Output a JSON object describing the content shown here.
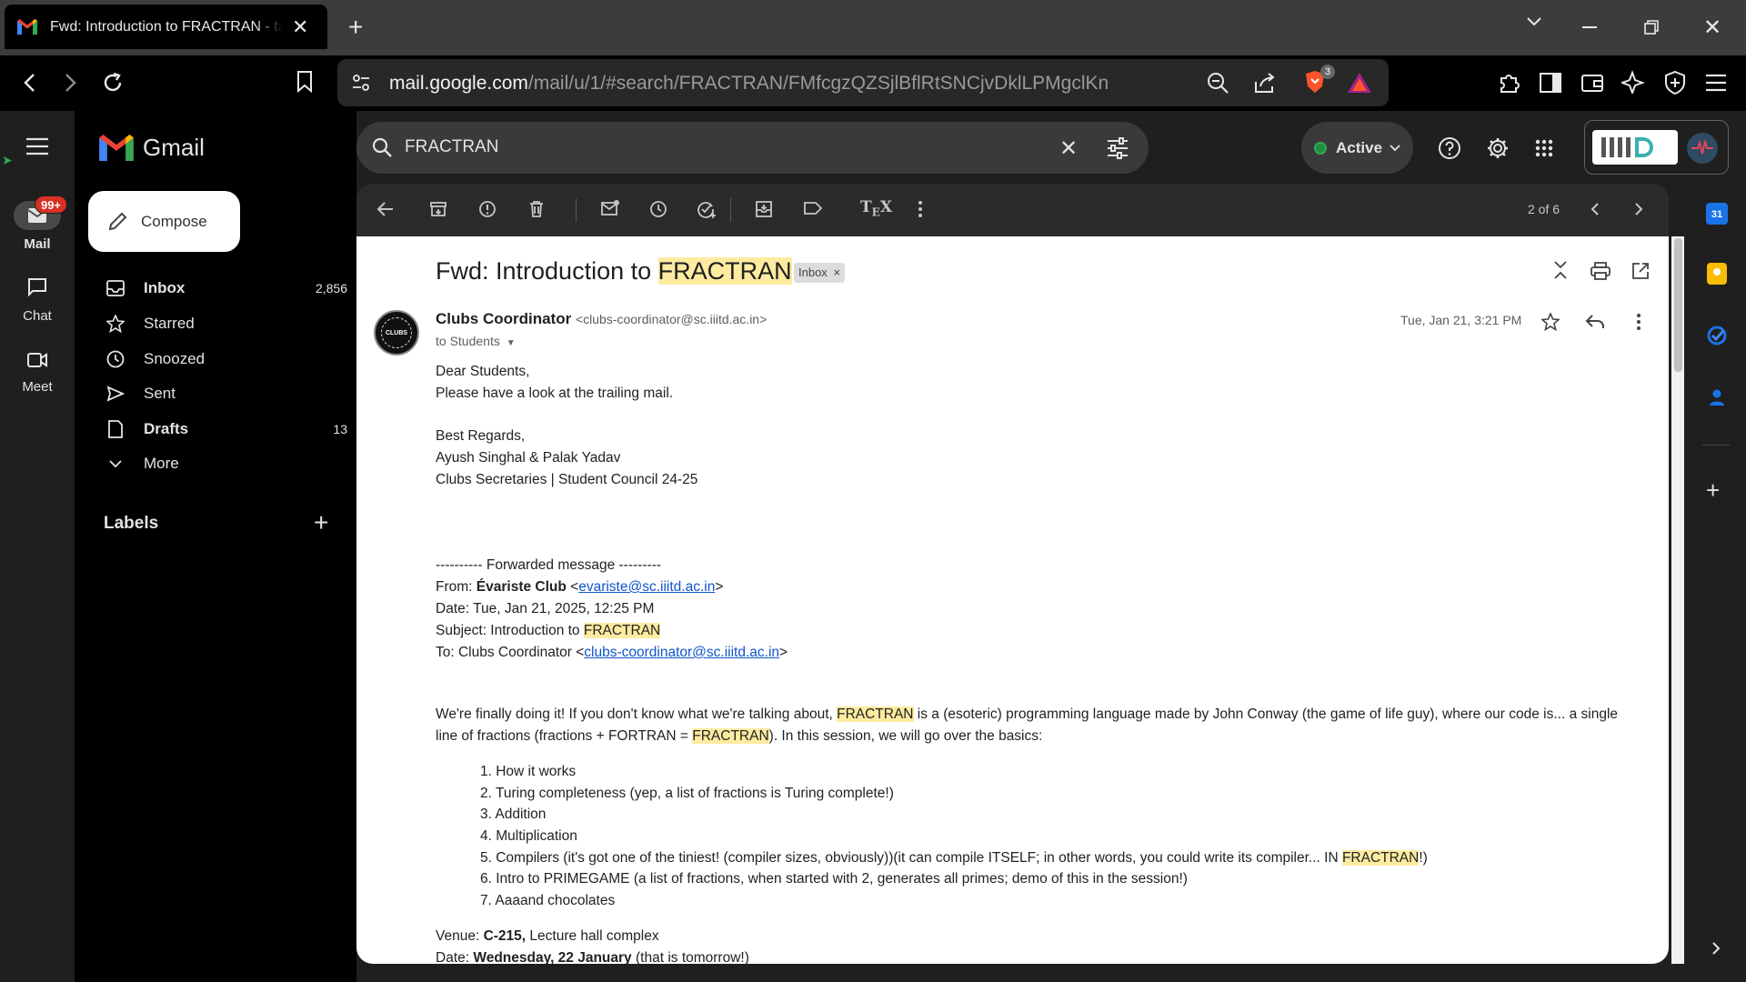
{
  "browser": {
    "tab_title": "Fwd: Introduction to FRACTRAN - tara",
    "url_domain": "mail.google.com",
    "url_path": "/mail/u/1/#search/FRACTRAN/FMfcgzQZSjlBflRtSNCjvDklLPMgclKn",
    "brave_badge": "3"
  },
  "rail": {
    "mail_label": "Mail",
    "mail_badge": "99+",
    "chat_label": "Chat",
    "meet_label": "Meet"
  },
  "app": {
    "name": "Gmail"
  },
  "compose_label": "Compose",
  "nav": [
    {
      "label": "Inbox",
      "count": "2,856",
      "icon": "inbox-icon"
    },
    {
      "label": "Starred",
      "count": "",
      "icon": "star-icon"
    },
    {
      "label": "Snoozed",
      "count": "",
      "icon": "clock-icon"
    },
    {
      "label": "Sent",
      "count": "",
      "icon": "send-icon"
    },
    {
      "label": "Drafts",
      "count": "13",
      "icon": "draft-icon"
    },
    {
      "label": "More",
      "count": "",
      "icon": "chevron-down-icon"
    }
  ],
  "labels_heading": "Labels",
  "search": {
    "query": "FRACTRAN"
  },
  "status": {
    "label": "Active"
  },
  "pagination": "2 of 6",
  "message": {
    "subject_prefix": "Fwd: Introduction to ",
    "subject_highlight": "FRACTRAN",
    "label_chip": "Inbox",
    "sender_name": "Clubs Coordinator",
    "sender_email": "<clubs-coordinator@sc.iiitd.ac.in>",
    "to_line": "to Students",
    "date": "Tue, Jan 21, 3:21 PM",
    "avatar_text": "CLUBS"
  },
  "body": {
    "l1": "Dear Students,",
    "l2": "Please have a look at the trailing mail.",
    "l3": "Best Regards,",
    "l4": "Ayush Singhal & Palak Yadav",
    "l5": "Clubs Secretaries | Student Council 24-25",
    "fwd": "---------- Forwarded message ---------",
    "from_label": "From: ",
    "from_name": "Évariste Club",
    "from_email": "evariste@sc.iiitd.ac.in",
    "date_line": "Date: Tue, Jan 21, 2025, 12:25 PM",
    "subject_label": "Subject: Introduction to ",
    "subject_hl": "FRACTRAN",
    "to_label": "To: Clubs Coordinator <",
    "to_email": "clubs-coordinator@sc.iiitd.ac.in",
    "p1a": "We're finally doing it! If you don't know what we're talking about, ",
    "p1b": "FRACTRAN",
    "p1c": " is a (esoteric) programming language made by John Conway (the game of life guy), where our code is... a single",
    "p2a": "line of fractions (fractions + FORTRAN = ",
    "p2b": "FRACTRAN",
    "p2c": "). In this session, we will go over the basics:",
    "list": [
      "1. How it works",
      "2. Turing completeness (yep, a list of fractions is Turing complete!)",
      "3. Addition",
      "4. Multiplication",
      "5. Compilers (it's got one of the tiniest! (compiler sizes, obviously))(it can compile ITSELF; in other words, you could write its compiler... IN ",
      "6. Intro to PRIMEGAME (a list of fractions, when started with 2, generates all primes; demo of this in the session!)",
      "7. Aaaand chocolates"
    ],
    "list5_hl": "FRACTRAN",
    "list5_end": "!)",
    "venue_label": "Venue: ",
    "venue_bold": "C-215,",
    "venue_rest": " Lecture hall complex",
    "date2_label": "Date: ",
    "date2_bold": "Wednesday, 22 January",
    "date2_rest": " (that is tomorrow!)"
  }
}
